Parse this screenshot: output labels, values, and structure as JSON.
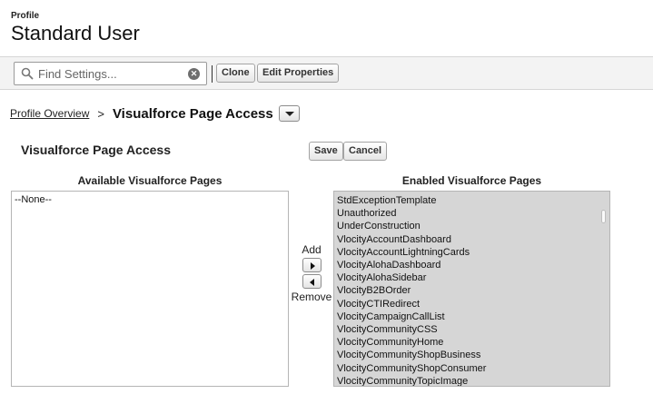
{
  "header": {
    "eyebrow": "Profile",
    "title": "Standard User"
  },
  "toolbar": {
    "search_placeholder": "Find Settings...",
    "clone_label": "Clone",
    "edit_properties_label": "Edit Properties"
  },
  "breadcrumb": {
    "link": "Profile Overview",
    "separator": ">",
    "current": "Visualforce Page Access"
  },
  "section": {
    "title": "Visualforce Page Access",
    "save_label": "Save",
    "cancel_label": "Cancel"
  },
  "available": {
    "heading": "Available Visualforce Pages",
    "items": [
      "--None--"
    ]
  },
  "mover": {
    "add_label": "Add",
    "remove_label": "Remove"
  },
  "enabled": {
    "heading": "Enabled Visualforce Pages",
    "items": [
      "StdExceptionTemplate",
      "Unauthorized",
      "UnderConstruction",
      "VlocityAccountDashboard",
      "VlocityAccountLightningCards",
      "VlocityAlohaDashboard",
      "VlocityAlohaSidebar",
      "VlocityB2BOrder",
      "VlocityCTIRedirect",
      "VlocityCampaignCallList",
      "VlocityCommunityCSS",
      "VlocityCommunityHome",
      "VlocityCommunityShopBusiness",
      "VlocityCommunityShopConsumer",
      "VlocityCommunityTopicImage"
    ]
  },
  "icons": {
    "search": "search-icon",
    "clear": "clear-icon",
    "dropdown": "chevron-down-icon",
    "add": "arrow-right-icon",
    "remove": "arrow-left-icon"
  }
}
